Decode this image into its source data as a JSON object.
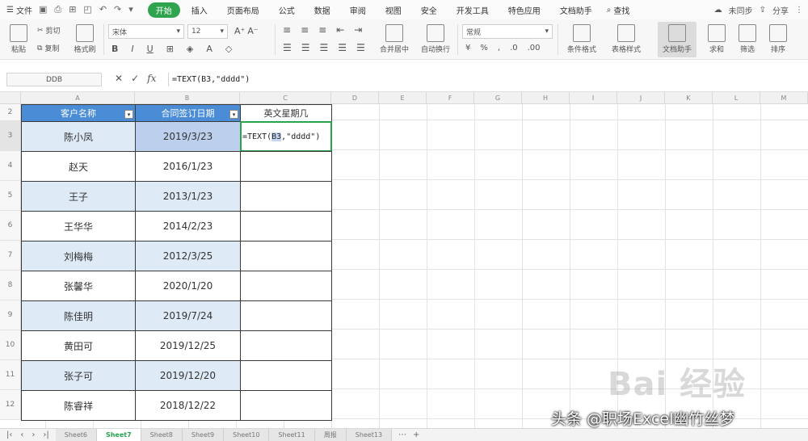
{
  "menubar": {
    "file_label": "文件",
    "tabs": [
      "开始",
      "插入",
      "页面布局",
      "公式",
      "数据",
      "审阅",
      "视图",
      "安全",
      "开发工具",
      "特色应用",
      "文档助手"
    ],
    "active_tab": 0,
    "search_label": "查找",
    "collab_label": "未同步",
    "share_label": "分享"
  },
  "ribbon": {
    "paste_label": "粘贴",
    "cut_label": "剪切",
    "copy_label": "复制",
    "format_painter_label": "格式刷",
    "font_name": "宋体",
    "font_size": "12",
    "merge_label": "合并居中",
    "wrap_label": "自动换行",
    "number_format": "常规",
    "cond_format_label": "条件格式",
    "table_style_label": "表格样式",
    "convert_label": "文档助手",
    "sum_label": "求和",
    "filter_label": "筛选",
    "sort_label": "排序"
  },
  "formula_bar": {
    "name_box": "DDB",
    "fx_label": "fx",
    "formula": "=TEXT(B3,\"dddd\")"
  },
  "columns": [
    "A",
    "B",
    "C",
    "D",
    "E",
    "F",
    "G",
    "H",
    "I",
    "J",
    "K",
    "L",
    "M"
  ],
  "rows": [
    "2",
    "3",
    "4",
    "5",
    "6",
    "7",
    "8",
    "9",
    "10",
    "11",
    "12"
  ],
  "table": {
    "headers": [
      "客户名称",
      "合同签订日期",
      "英文星期几"
    ],
    "data": [
      [
        "陈小凤",
        "2019/3/23"
      ],
      [
        "赵天",
        "2016/1/23"
      ],
      [
        "王子",
        "2013/1/23"
      ],
      [
        "王华华",
        "2014/2/23"
      ],
      [
        "刘梅梅",
        "2012/3/25"
      ],
      [
        "张馨华",
        "2020/1/20"
      ],
      [
        "陈佳明",
        "2019/7/24"
      ],
      [
        "黄田可",
        "2019/12/25"
      ],
      [
        "张子可",
        "2019/12/20"
      ],
      [
        "陈睿祥",
        "2018/12/22"
      ]
    ],
    "editing_cell": {
      "prefix": "=TEXT(",
      "ref": "B3",
      "suffix": ",\"dddd\")"
    },
    "filter_arrow": "▾"
  },
  "sheet_tabs": [
    "Sheet6",
    "Sheet7",
    "Sheet8",
    "Sheet9",
    "Sheet10",
    "Sheet11",
    "周报",
    "Sheet13"
  ],
  "active_sheet": 1,
  "watermark_text": "Bai 经验",
  "credit_text": "头条 @职场Excel幽竹丝梦",
  "colors": {
    "accent_green": "#2fa34d",
    "header_blue": "#4a8cd6",
    "band_blue": "#deeaf6",
    "selected_blue": "#bcd0ee"
  }
}
